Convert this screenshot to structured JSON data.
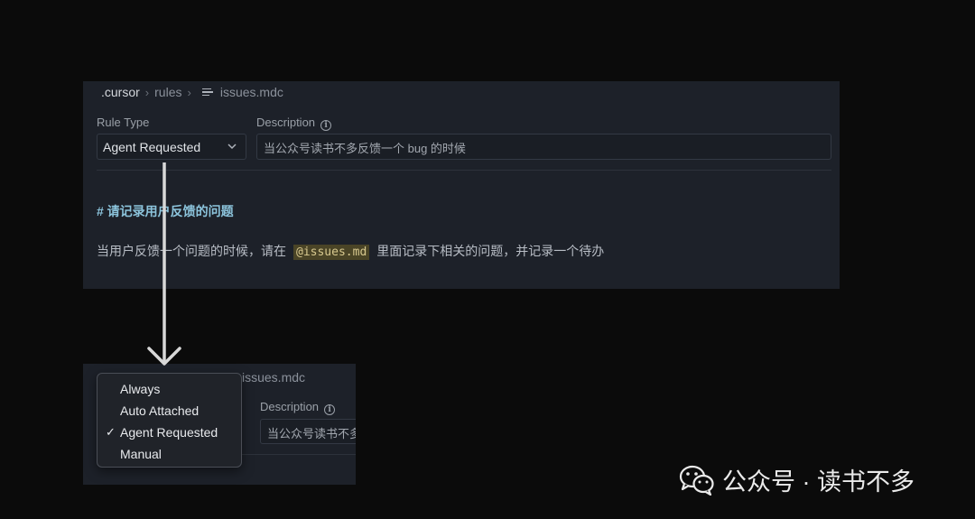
{
  "top_panel": {
    "breadcrumb": {
      "folder": ".cursor",
      "subfolder": "rules",
      "file": "issues.mdc"
    },
    "rule_type": {
      "label": "Rule Type",
      "value": "Agent Requested"
    },
    "description": {
      "label": "Description",
      "value": "当公众号读书不多反馈一个 bug 的时候"
    },
    "heading": "# 请记录用户反馈的问题",
    "body": {
      "before": "当用户反馈一个问题的时候，请在",
      "mention": "@issues.md",
      "after": "里面记录下相关的问题，并记录一个待办"
    }
  },
  "bottom_panel": {
    "breadcrumb_file": "issues.mdc",
    "description_label": "Description",
    "description_value": "当公众号读书不多反馈一个 bug 的时候"
  },
  "dropdown": {
    "options": [
      "Always",
      "Auto Attached",
      "Agent Requested",
      "Manual"
    ],
    "selected": "Agent Requested",
    "check_mark": "✓"
  },
  "watermark": {
    "text": "公众号 · 读书不多",
    "icon": "wechat-icon"
  },
  "colors": {
    "background": "#0b0b0b",
    "panel": "#1d2129",
    "heading": "#8cc4dc",
    "mention_bg": "#4a4426"
  }
}
